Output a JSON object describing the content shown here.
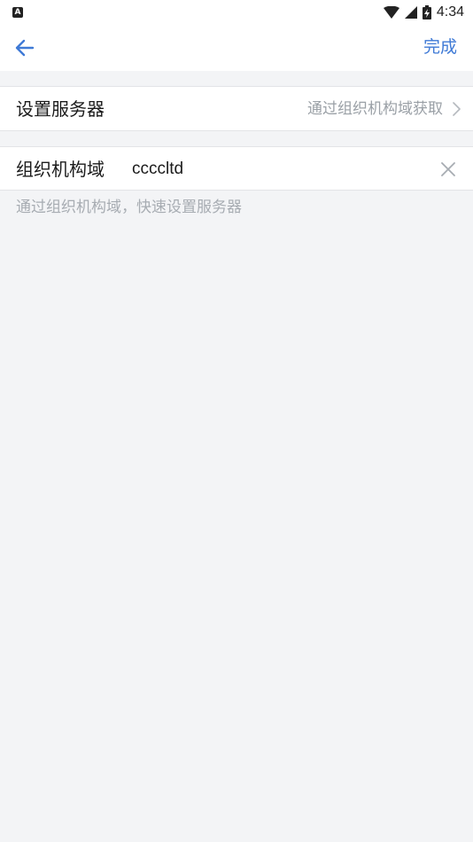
{
  "status_bar": {
    "app_icon_letter": "A",
    "time": "4:34",
    "icons": [
      "wifi-icon",
      "cellular-signal-icon",
      "battery-charging-icon"
    ]
  },
  "app_bar": {
    "back_icon": "arrow-left-icon",
    "done_label": "完成"
  },
  "server_row": {
    "label": "设置服务器",
    "value": "通过组织机构域获取",
    "chevron_icon": "chevron-right-icon"
  },
  "domain_row": {
    "label": "组织机构域",
    "input_value": "cccсltd",
    "clear_icon": "close-icon"
  },
  "hint": "通过组织机构域，快速设置服务器",
  "colors": {
    "accent": "#3f7ad6",
    "background": "#f3f4f6",
    "secondary_text": "#9aa0a6"
  }
}
